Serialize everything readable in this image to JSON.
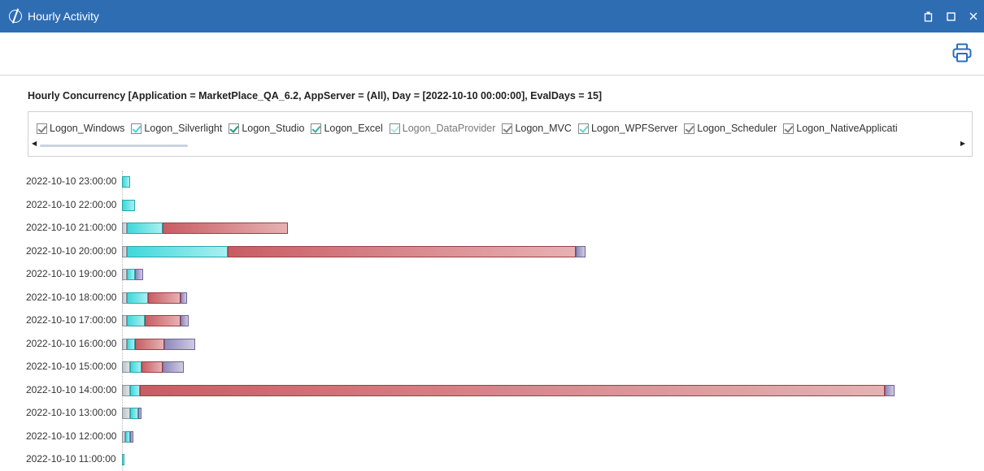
{
  "window": {
    "title": "Hourly Activity"
  },
  "report": {
    "heading": "Hourly Concurrency  [Application = MarketPlace_QA_6.2, AppServer = (All), Day = [2022-10-10 00:00:00], EvalDays = 15]"
  },
  "legend": {
    "items": [
      {
        "label": "Logon_Windows",
        "checked": true,
        "color": "#808080"
      },
      {
        "label": "Logon_Silverlight",
        "checked": true,
        "color": "#3ed8dc"
      },
      {
        "label": "Logon_Studio",
        "checked": true,
        "color": "#1a9c7a"
      },
      {
        "label": "Logon_Excel",
        "checked": true,
        "color": "#2bb59a"
      },
      {
        "label": "Logon_DataProvider",
        "checked": true,
        "color": "#a8e8e0"
      },
      {
        "label": "Logon_MVC",
        "checked": true,
        "color": "#808080"
      },
      {
        "label": "Logon_WPFServer",
        "checked": true,
        "color": "#62d6c8"
      },
      {
        "label": "Logon_Scheduler",
        "checked": true,
        "color": "#808080"
      },
      {
        "label": "Logon_NativeApplicati",
        "checked": true,
        "color": "#808080"
      }
    ]
  },
  "chart_data": {
    "type": "bar",
    "orientation": "horizontal",
    "stacked": true,
    "categories": [
      "2022-10-10 23:00:00",
      "2022-10-10 22:00:00",
      "2022-10-10 21:00:00",
      "2022-10-10 20:00:00",
      "2022-10-10 19:00:00",
      "2022-10-10 18:00:00",
      "2022-10-10 17:00:00",
      "2022-10-10 16:00:00",
      "2022-10-10 15:00:00",
      "2022-10-10 14:00:00",
      "2022-10-10 13:00:00",
      "2022-10-10 12:00:00",
      "2022-10-10 11:00:00"
    ],
    "series": [
      {
        "color": "#c8cdd1",
        "values": [
          0,
          0,
          6,
          6,
          6,
          6,
          6,
          6,
          10,
          10,
          10,
          4,
          0
        ]
      },
      {
        "color": "#3ed8dc",
        "values": [
          10,
          16,
          44,
          124,
          10,
          26,
          22,
          10,
          14,
          12,
          10,
          6,
          3
        ]
      },
      {
        "color": "#c85d64",
        "values": [
          0,
          0,
          154,
          428,
          0,
          40,
          44,
          36,
          26,
          916,
          0,
          0,
          0
        ]
      },
      {
        "color": "#8f88b8",
        "values": [
          0,
          0,
          0,
          12,
          10,
          8,
          10,
          38,
          26,
          12,
          4,
          4,
          0
        ]
      }
    ]
  }
}
